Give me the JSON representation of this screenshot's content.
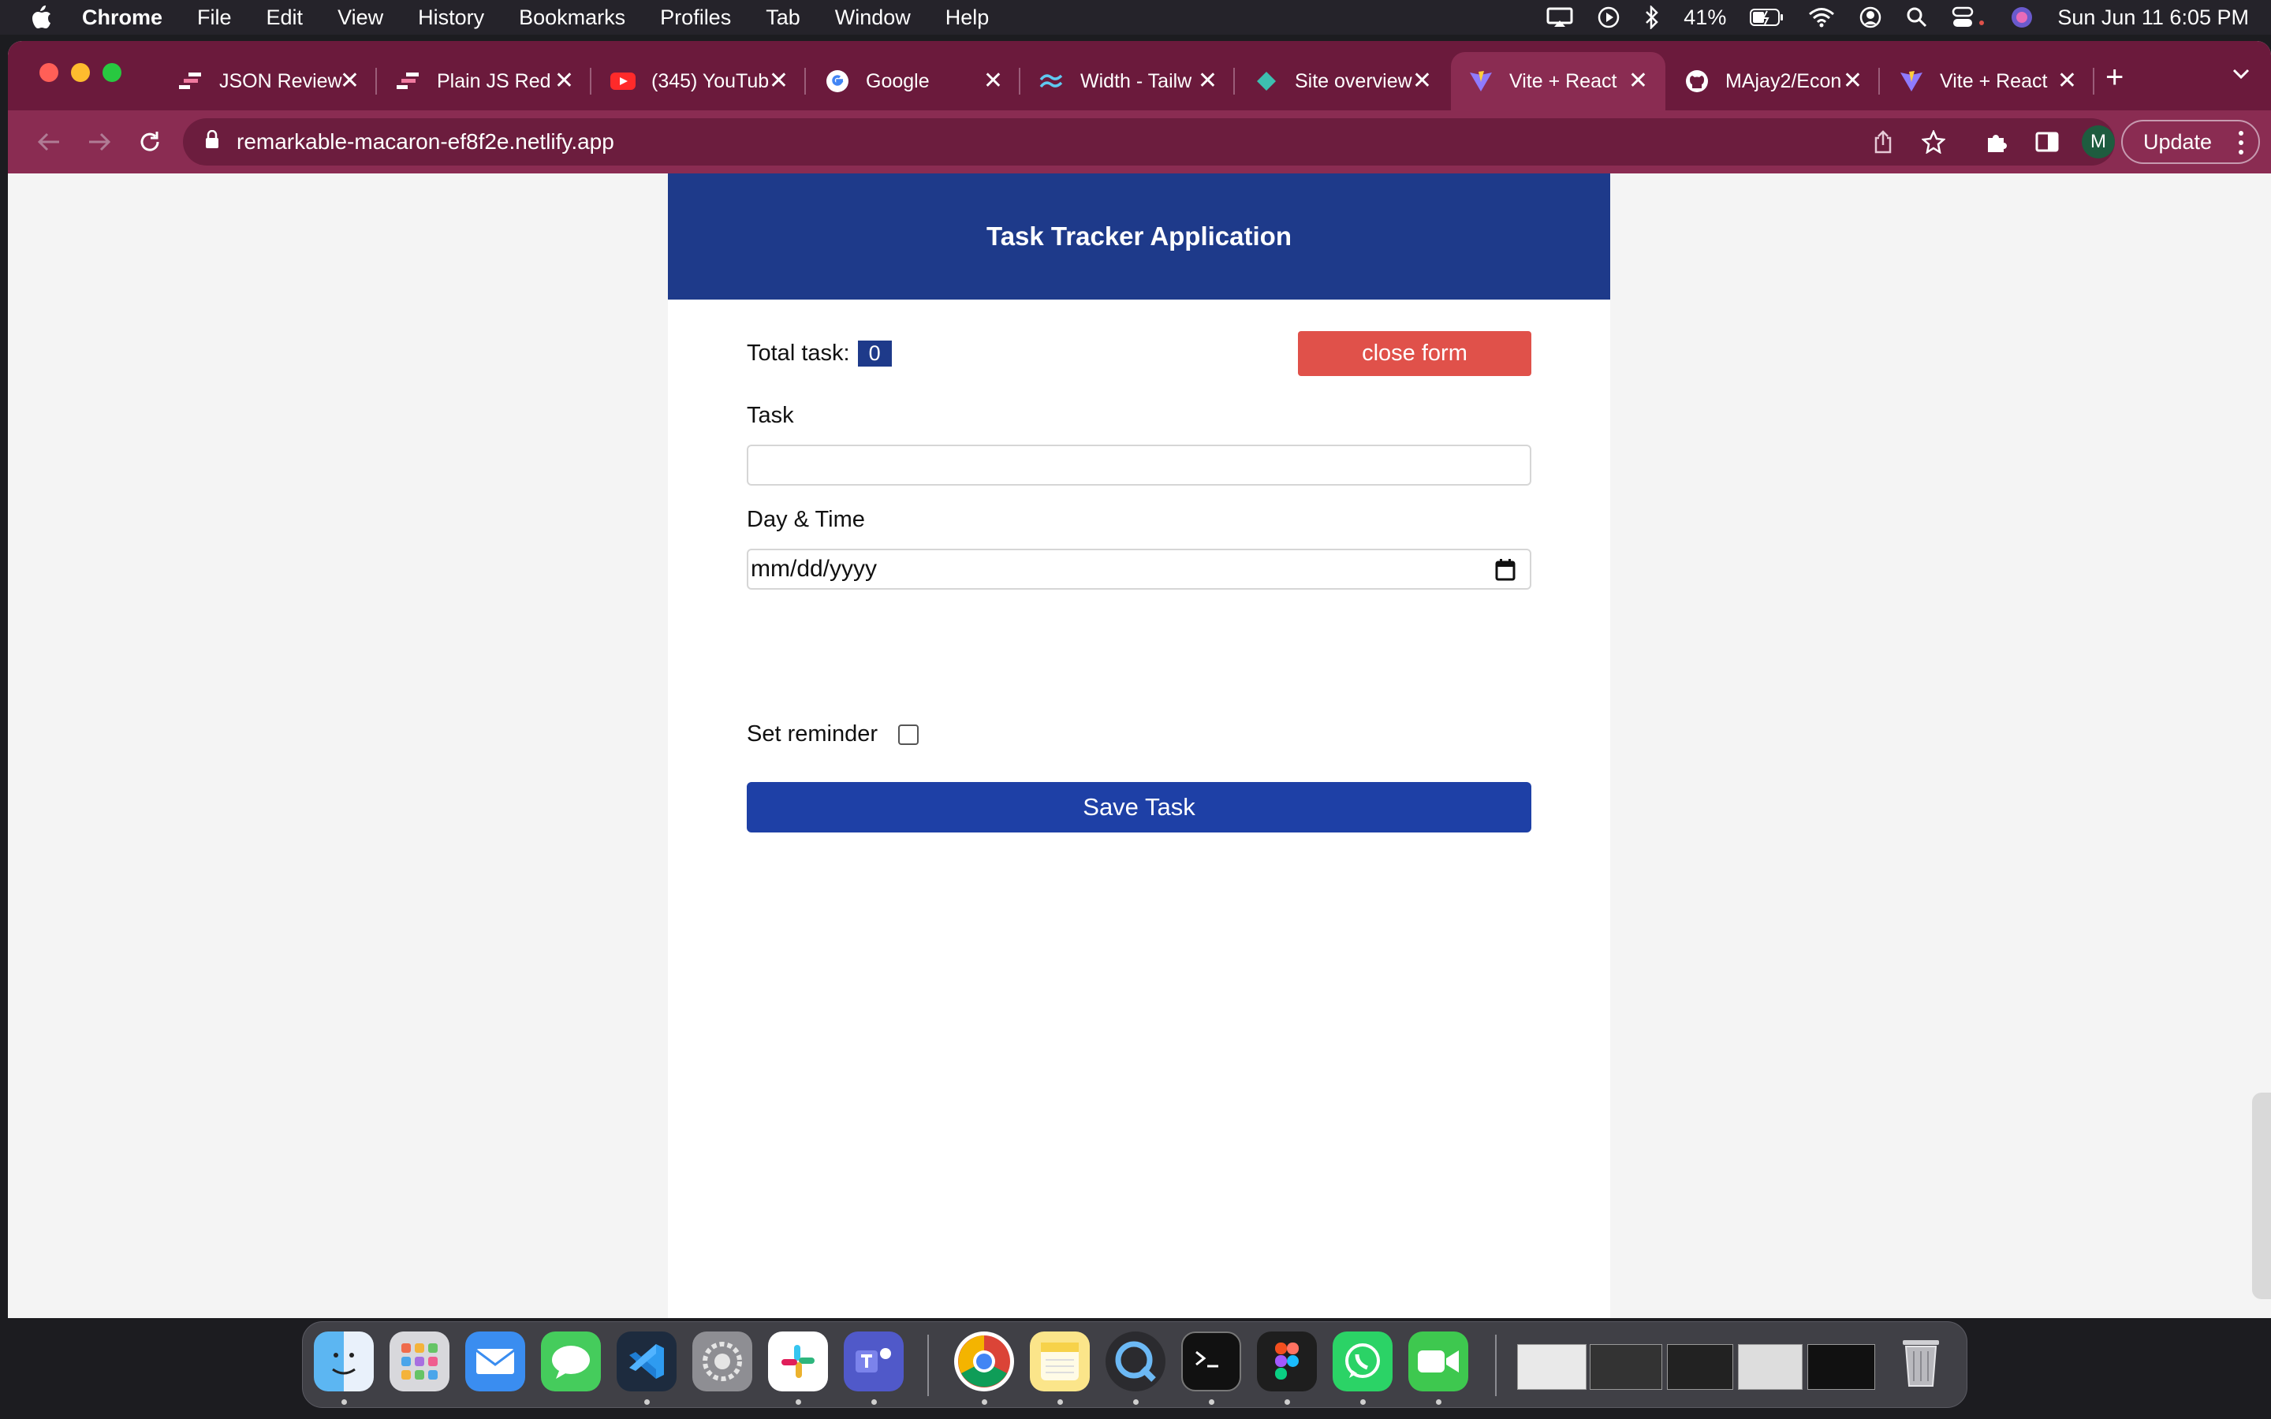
{
  "menubar": {
    "app_name": "Chrome",
    "items": [
      "File",
      "Edit",
      "View",
      "History",
      "Bookmarks",
      "Profiles",
      "Tab",
      "Window",
      "Help"
    ],
    "battery": "41%",
    "clock": "Sun Jun 11  6:05 PM"
  },
  "tabs": [
    {
      "title": "JSON Review",
      "icon": "stack-icon"
    },
    {
      "title": "Plain JS Red",
      "icon": "stack-icon"
    },
    {
      "title": "(345) YouTub",
      "icon": "youtube-icon"
    },
    {
      "title": "Google",
      "icon": "google-icon"
    },
    {
      "title": "Width - Tailw",
      "icon": "tailwind-icon"
    },
    {
      "title": "Site overview",
      "icon": "netlify-icon"
    },
    {
      "title": "Vite + React",
      "icon": "vite-icon",
      "active": true
    },
    {
      "title": "MAjay2/Econ",
      "icon": "github-icon"
    },
    {
      "title": "Vite + React",
      "icon": "vite-icon"
    }
  ],
  "address_bar": {
    "url": "remarkable-macaron-ef8f2e.netlify.app"
  },
  "profile_initial": "M",
  "update_label": "Update",
  "app": {
    "header_title": "Task Tracker Application",
    "total_label": "Total task:",
    "total_count": "0",
    "close_form_label": "close form",
    "task_label": "Task",
    "task_value": "",
    "day_time_label": "Day & Time",
    "date_placeholder": "mm/dd/yyyy",
    "reminder_label": "Set reminder",
    "reminder_checked": false,
    "save_label": "Save Task"
  },
  "colors": {
    "tab_strip": "#6b1a3c",
    "toolbar": "#8a2c52",
    "header_blue": "#1e3a8a",
    "close_red": "#e0514a",
    "save_blue": "#1e40a6"
  },
  "dock": {
    "apps": [
      "finder-icon",
      "launchpad-icon",
      "mail-icon",
      "messages-icon",
      "vscode-icon",
      "system-settings-icon",
      "slack-icon",
      "teams-icon",
      "chrome-icon",
      "notes-icon",
      "quicktime-icon",
      "terminal-icon",
      "figma-icon",
      "whatsapp-icon",
      "facetime-icon"
    ]
  }
}
